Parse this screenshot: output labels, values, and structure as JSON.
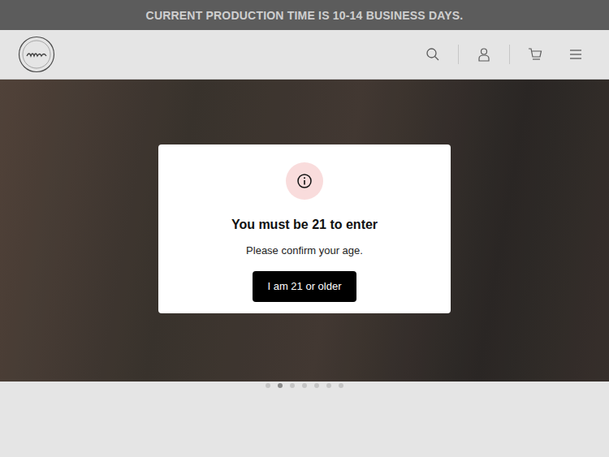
{
  "announcement": {
    "text": "CURRENT PRODUCTION TIME IS 10-14 BUSINESS DAYS."
  },
  "hero": {
    "dots": [
      {
        "selected": false
      },
      {
        "selected": true
      },
      {
        "selected": false
      },
      {
        "selected": false
      },
      {
        "selected": false
      },
      {
        "selected": false
      },
      {
        "selected": false
      }
    ]
  },
  "age_modal": {
    "title": "You must be 21 to enter",
    "message": "Please confirm your age.",
    "button": "I am 21 or older"
  }
}
